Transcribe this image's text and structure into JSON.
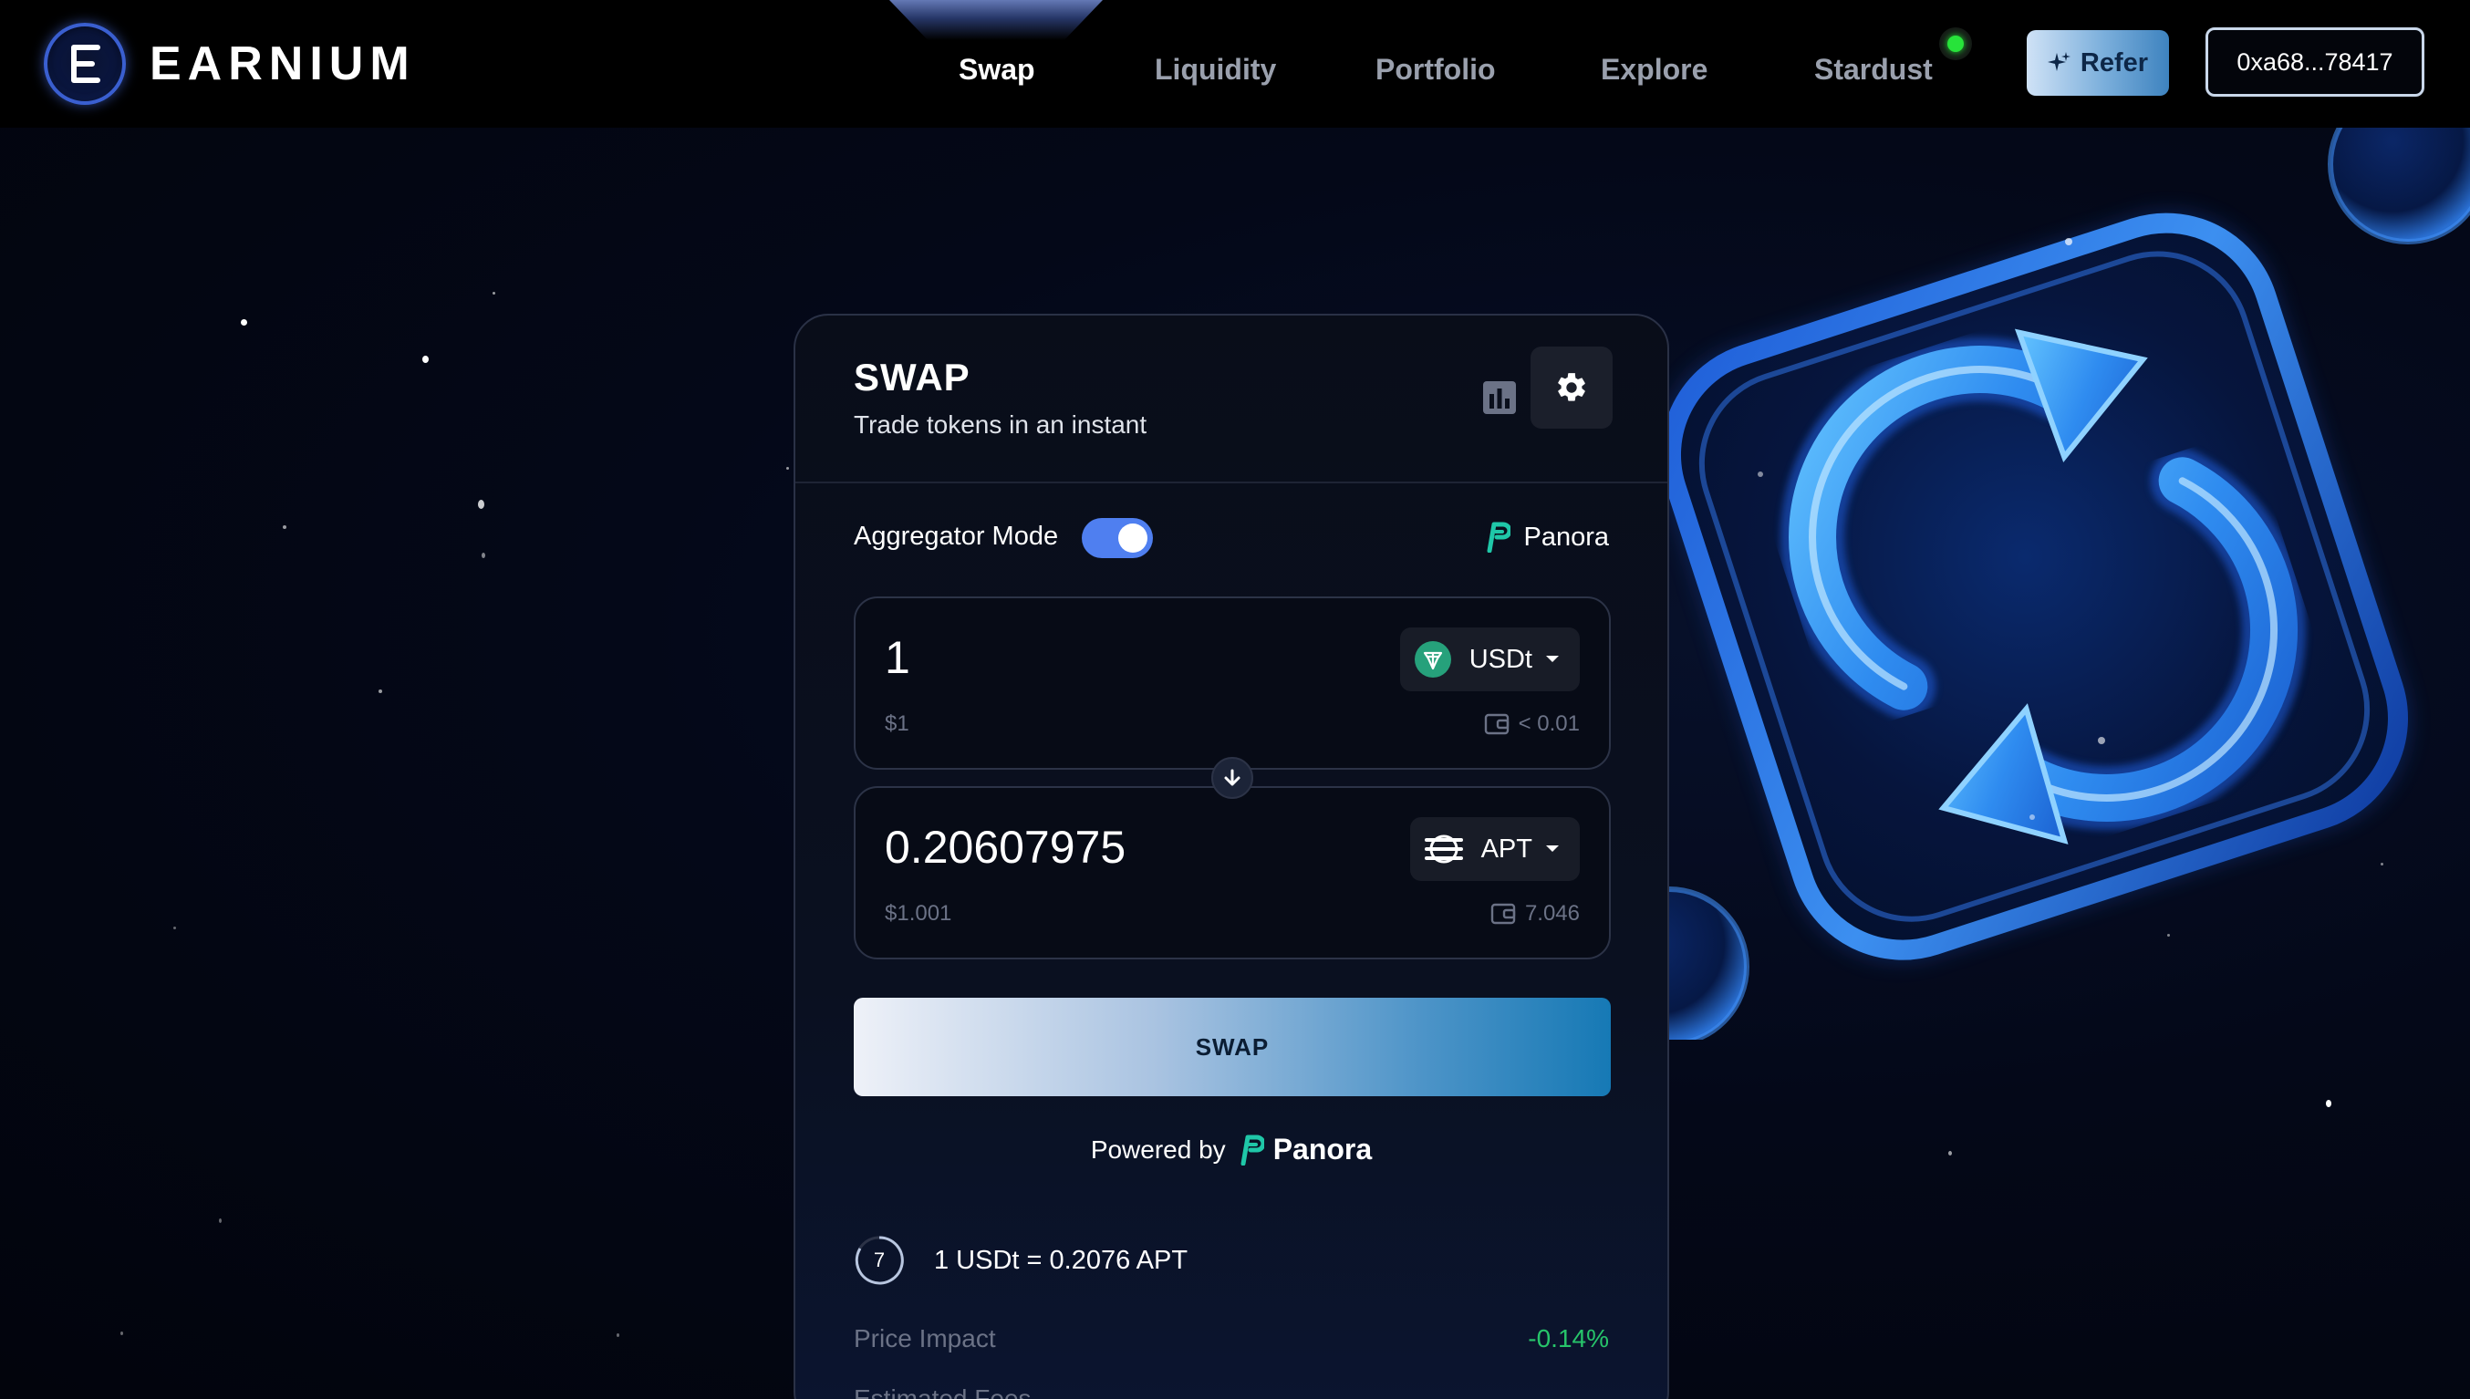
{
  "navbar": {
    "brand": "EARNIUM",
    "items": [
      {
        "label": "Swap",
        "active": true
      },
      {
        "label": "Liquidity",
        "active": false
      },
      {
        "label": "Portfolio",
        "active": false
      },
      {
        "label": "Explore",
        "active": false
      },
      {
        "label": "Stardust",
        "active": false
      }
    ],
    "refer_label": "Refer",
    "wallet_label": "0xa68...78417",
    "status_color": "#27e33a"
  },
  "swap_card": {
    "title": "SWAP",
    "subtitle": "Trade tokens in an instant",
    "aggregator_label": "Aggregator Mode",
    "aggregator_enabled": true,
    "aggregator_provider": "Panora",
    "from": {
      "amount": "1",
      "usd_value": "$1",
      "token": "USDt",
      "token_icon": "tether-icon",
      "balance": "< 0.01"
    },
    "to": {
      "amount": "0.20607975",
      "usd_value": "$1.001",
      "token": "APT",
      "token_icon": "aptos-icon",
      "balance": "7.046"
    },
    "swap_button_label": "SWAP",
    "powered_by_label": "Powered by",
    "powered_by_name": "Panora",
    "refresh_countdown": "7",
    "rate_text": "1 USDt = 0.2076 APT",
    "price_impact_label": "Price Impact",
    "price_impact_value": "-0.14%",
    "estimated_fees_label": "Estimated Fees"
  },
  "colors": {
    "accent": "#4f7ff0",
    "positive": "#27c46a",
    "panora": "#1fc7a8"
  }
}
